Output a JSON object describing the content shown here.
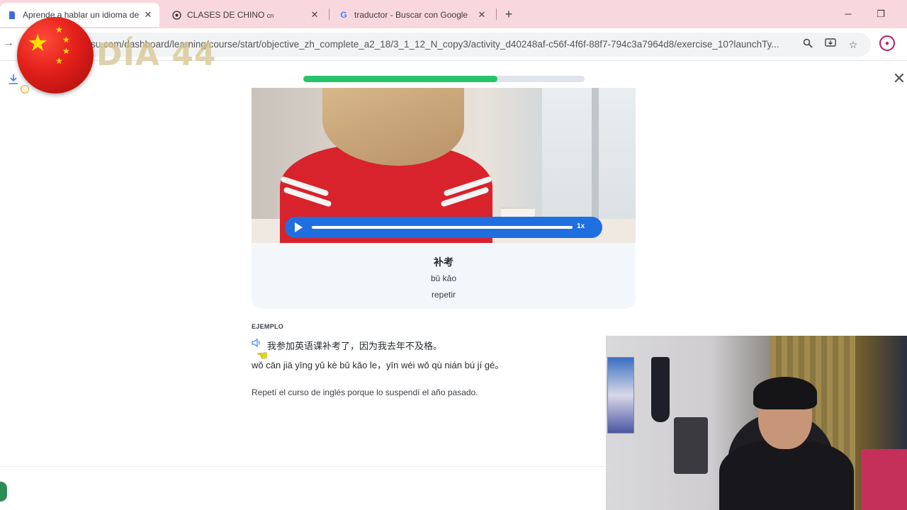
{
  "browser": {
    "tabs": [
      {
        "title": "Aprende a hablar un idioma de",
        "active": true
      },
      {
        "title": "CLASES DE CHINO",
        "suffix": "cn",
        "active": false
      },
      {
        "title": "traductor - Buscar con Google",
        "active": false
      }
    ],
    "url": "su.com/dashboard/learning/course/start/objective_zh_complete_a2_18/3_1_12_N_copy3/activity_d40248af-c56f-4f6f-88f7-794c3a7964d8/exercise_10?launchTy..."
  },
  "overlay": {
    "day_label": "DÍA 44"
  },
  "lesson": {
    "progress_percent": 69,
    "player": {
      "speed": "1x"
    },
    "word": {
      "hanzi": "补考",
      "pinyin": "bǔ kǎo",
      "translation": "repetir"
    },
    "example": {
      "label": "EJEMPLO",
      "hanzi": "我参加英语课补考了，因为我去年不及格。",
      "pinyin": "wǒ cān jiā yīng yǔ kè bǔ kǎo le，yīn wéi wǒ qù nián bú jí gé。",
      "translation": "Repetí el curso de inglés porque lo suspendí el año pasado."
    }
  },
  "colors": {
    "progress": "#25c46a",
    "player": "#1f6fe0",
    "tabbar": "#f9d7df"
  }
}
